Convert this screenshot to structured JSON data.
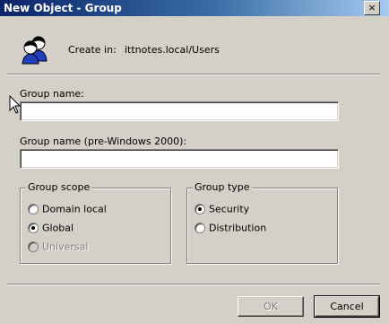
{
  "window": {
    "title": "New Object - Group",
    "close_glyph": "×"
  },
  "header": {
    "icon": "group-users-icon",
    "create_in_label": "Create in:",
    "create_in_value": "ittnotes.local/Users"
  },
  "form": {
    "group_name_label": "Group name:",
    "group_name_value": "",
    "group_name_pre2000_label": "Group name (pre-Windows 2000):",
    "group_name_pre2000_value": ""
  },
  "group_scope": {
    "legend": "Group scope",
    "options": [
      {
        "label": "Domain local",
        "checked": false,
        "disabled": false
      },
      {
        "label": "Global",
        "checked": true,
        "disabled": false
      },
      {
        "label": "Universal",
        "checked": false,
        "disabled": true
      }
    ]
  },
  "group_type": {
    "legend": "Group type",
    "options": [
      {
        "label": "Security",
        "checked": true,
        "disabled": false
      },
      {
        "label": "Distribution",
        "checked": false,
        "disabled": false
      }
    ]
  },
  "buttons": {
    "ok": "OK",
    "cancel": "Cancel"
  },
  "colors": {
    "titlebar_start": "#0a246a",
    "titlebar_end": "#a6caf0",
    "dialog_bg": "#d4d0c8"
  }
}
